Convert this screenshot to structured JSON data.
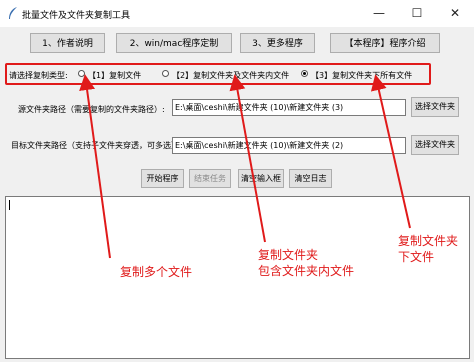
{
  "window": {
    "title": "批量文件及文件夹复制工具"
  },
  "window_controls": {
    "minimize": "—",
    "maximize": "☐",
    "close": "✕"
  },
  "top_buttons": [
    "1、作者说明",
    "2、win/mac程序定制",
    "3、更多程序",
    "【本程序】程序介绍"
  ],
  "copy_type": {
    "label": "请选择复制类型:",
    "options": [
      "【1】复制文件",
      "【2】复制文件夹及文件夹内文件",
      "【3】复制文件夹下所有文件"
    ],
    "selected_index": 2
  },
  "source": {
    "label": "源文件夹路径（需要复制的文件夹路径）:",
    "value": "E:\\桌面\\ceshi\\新建文件夹 (10)\\新建文件夹 (3)",
    "browse": "选择文件夹"
  },
  "target": {
    "label": "目标文件夹路径（支持子文件夹穿透，可多选）:",
    "value": "E:\\桌面\\ceshi\\新建文件夹 (10)\\新建文件夹 (2)",
    "browse": "选择文件夹"
  },
  "actions": [
    "开始程序",
    "结束任务",
    "清空输入框",
    "清空日志"
  ],
  "log_text": "",
  "annotations": {
    "a1": "复制多个文件",
    "a2_line1": "复制文件夹",
    "a2_line2": "包含文件夹内文件",
    "a3_line1": "复制文件夹",
    "a3_line2": "下文件"
  },
  "colors": {
    "annotation_red": "#e01a1a",
    "window_bg": "#f0f0f0",
    "button_bg": "#e1e1e1"
  }
}
